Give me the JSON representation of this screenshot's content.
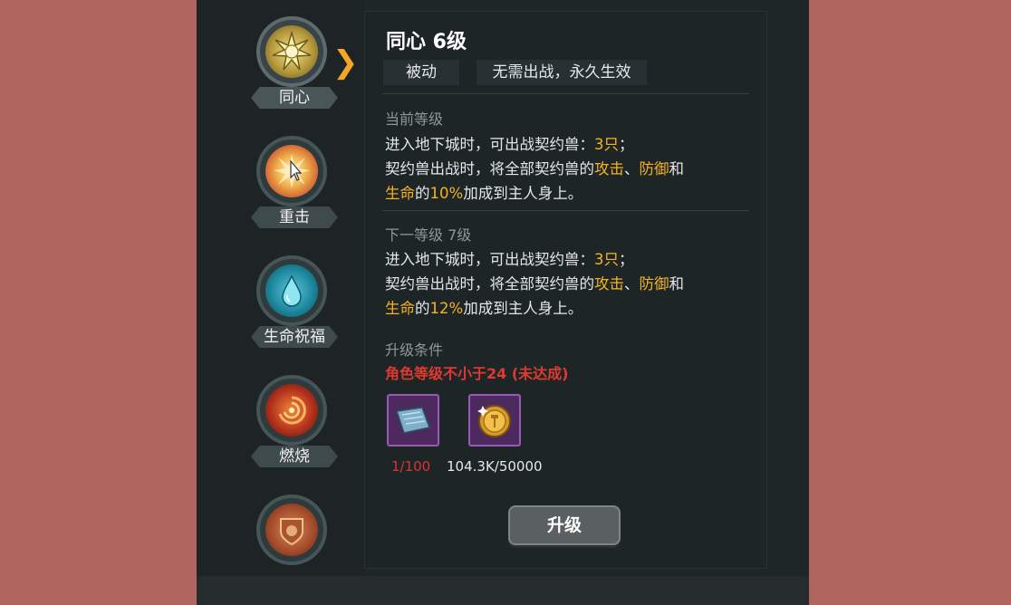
{
  "skills": [
    {
      "name": "同心",
      "icon": "sun-icon"
    },
    {
      "name": "重击",
      "icon": "burst-icon"
    },
    {
      "name": "生命祝福",
      "icon": "water-drop-icon"
    },
    {
      "name": "燃烧",
      "icon": "fire-swirl-icon"
    },
    {
      "name": "",
      "icon": "shield-icon"
    }
  ],
  "detail": {
    "title": "同心 6级",
    "type_tag": "被动",
    "effect_tag": "无需出战，永久生效",
    "current": {
      "heading": "当前等级",
      "l1a": "进入地下城时，可出战契约兽：",
      "l1n": "3只",
      "l1b": "；",
      "l2a": "契约兽出战时，将全部契约兽的",
      "l2atk": "攻击",
      "l2sep": "、",
      "l2def": "防御",
      "l2and": "和",
      "l3life": "生命",
      "l3of": "的",
      "l3pct": "10%",
      "l3rest": "加成到主人身上。"
    },
    "next": {
      "heading": "下一等级 7级",
      "l1a": "进入地下城时，可出战契约兽：",
      "l1n": "3只",
      "l1b": "；",
      "l2a": "契约兽出战时，将全部契约兽的",
      "l2atk": "攻击",
      "l2sep": "、",
      "l2def": "防御",
      "l2and": "和",
      "l3life": "生命",
      "l3of": "的",
      "l3pct": "12%",
      "l3rest": "加成到主人身上。"
    },
    "requirements": {
      "heading": "升级条件",
      "warning": "角色等级不小于24 (未达成)"
    },
    "materials": [
      {
        "icon": "scroll-icon",
        "count": "1/100",
        "color": "#d9362c"
      },
      {
        "icon": "gold-coin-icon",
        "count": "104.3K/50000",
        "color": "#e8e8e8"
      }
    ],
    "upgrade_label": "升级"
  },
  "colors": {
    "highlight": "#f5b323",
    "warning": "#e03a2f",
    "accent_arrow": "#f5a623"
  }
}
